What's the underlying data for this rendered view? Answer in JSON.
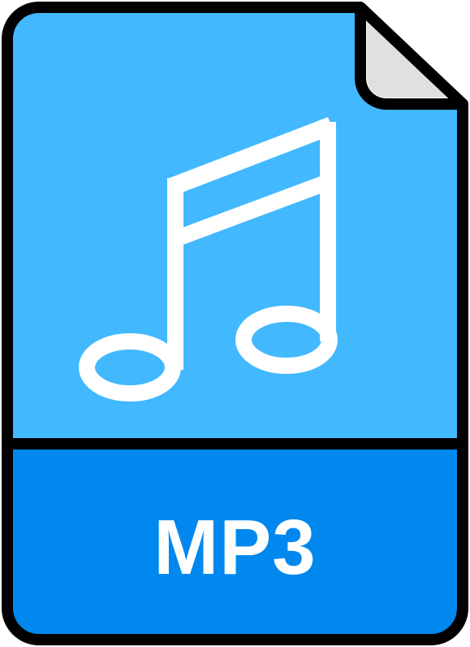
{
  "file_icon": {
    "extension_label": "MP3",
    "icon": "music-note-icon",
    "colors": {
      "body": "#42B8FF",
      "footer": "#0088EE",
      "outline": "#000000",
      "fold": "#E0E0E0",
      "glyph": "#FFFFFF"
    }
  }
}
